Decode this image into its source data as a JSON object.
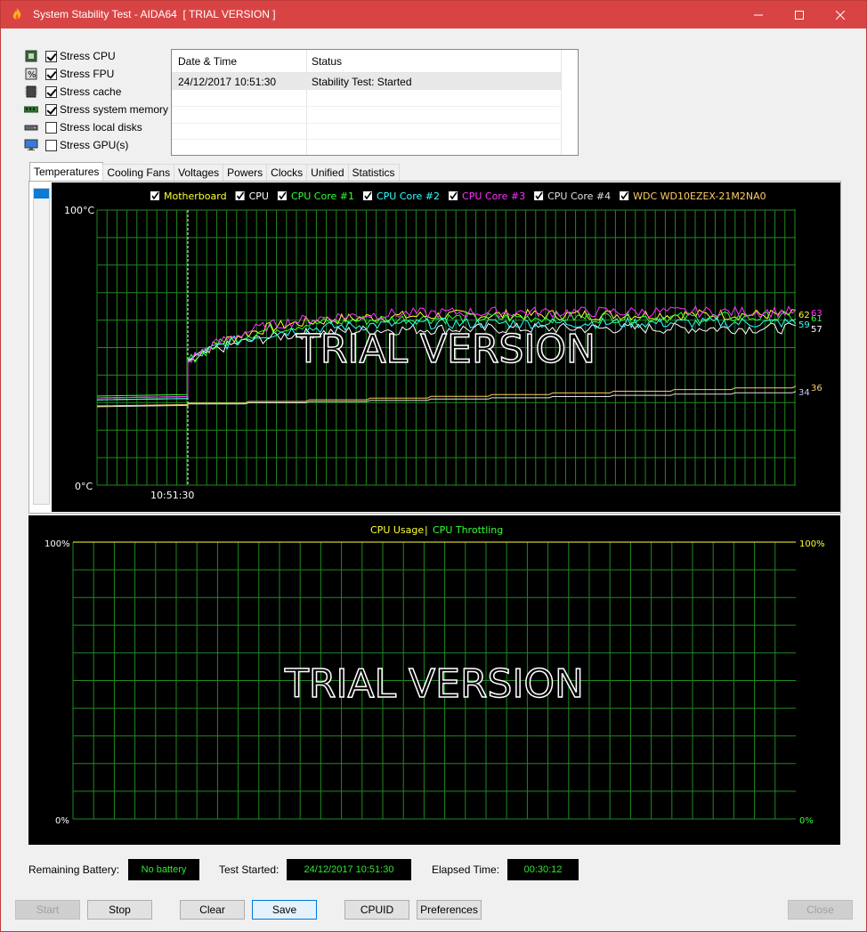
{
  "window": {
    "title": "System Stability Test - AIDA64  [ TRIAL VERSION ]",
    "accent": "#d84444"
  },
  "stress": [
    {
      "label": "Stress CPU",
      "checked": true,
      "icon": "cpu-chip-icon"
    },
    {
      "label": "Stress FPU",
      "checked": true,
      "icon": "fpu-percent-icon"
    },
    {
      "label": "Stress cache",
      "checked": true,
      "icon": "cache-chip-icon"
    },
    {
      "label": "Stress system memory",
      "checked": true,
      "icon": "memory-module-icon"
    },
    {
      "label": "Stress local disks",
      "checked": false,
      "icon": "disk-drive-icon"
    },
    {
      "label": "Stress GPU(s)",
      "checked": false,
      "icon": "monitor-gpu-icon"
    }
  ],
  "log": {
    "columns": [
      "Date & Time",
      "Status"
    ],
    "rows": [
      {
        "datetime": "24/12/2017 10:51:30",
        "status": "Stability Test: Started"
      }
    ]
  },
  "tabs": [
    "Temperatures",
    "Cooling Fans",
    "Voltages",
    "Powers",
    "Clocks",
    "Unified",
    "Statistics"
  ],
  "active_tab": "Temperatures",
  "watermark": "TRIAL VERSION",
  "temp_chart_data": {
    "type": "line",
    "y_top_label": "100°C",
    "y_bottom_label": "0°C",
    "ylim": [
      0,
      100
    ],
    "x_marker_label": "10:51:30",
    "grid": true,
    "legend_position": "top",
    "series": [
      {
        "name": "Motherboard",
        "color": "#ffff33",
        "checked": true,
        "end_value": 62
      },
      {
        "name": "CPU",
        "color": "#ffffff",
        "checked": true,
        "end_value": 57
      },
      {
        "name": "CPU Core #1",
        "color": "#33ff33",
        "checked": true,
        "end_value": 61
      },
      {
        "name": "CPU Core #2",
        "color": "#33ffff",
        "checked": true,
        "end_value": 59
      },
      {
        "name": "CPU Core #3",
        "color": "#ff33ff",
        "checked": true,
        "end_value": 63
      },
      {
        "name": "CPU Core #4",
        "color": "#e0e0e0",
        "checked": true,
        "end_value": 34
      },
      {
        "name": "WDC WD10EZEX-21M2NA0",
        "color": "#ffcc66",
        "checked": true,
        "end_value": 36
      }
    ],
    "end_labels": [
      {
        "text": "62",
        "color": "#ffff33"
      },
      {
        "text": "63",
        "color": "#ff33ff"
      },
      {
        "text": "61",
        "color": "#33ff33"
      },
      {
        "text": "59",
        "color": "#33ffff"
      },
      {
        "text": "57",
        "color": "#ffffff"
      },
      {
        "text": "36",
        "color": "#ffcc66"
      },
      {
        "text": "34",
        "color": "#ccccff"
      }
    ]
  },
  "usage_chart_data": {
    "type": "line",
    "legend": [
      {
        "name": "CPU Usage",
        "color": "#ffff33"
      },
      {
        "name": "CPU Throttling",
        "color": "#33ff33"
      }
    ],
    "separator": "|",
    "y_left_top": "100%",
    "y_left_bottom": "0%",
    "y_right_top": "100%",
    "y_right_bottom": "0%",
    "ylim": [
      0,
      100
    ],
    "grid": true
  },
  "status": {
    "battery_label": "Remaining Battery:",
    "battery_value": "No battery",
    "started_label": "Test Started:",
    "started_value": "24/12/2017 10:51:30",
    "elapsed_label": "Elapsed Time:",
    "elapsed_value": "00:30:12"
  },
  "buttons": {
    "start": "Start",
    "stop": "Stop",
    "clear": "Clear",
    "save": "Save",
    "cpuid": "CPUID",
    "preferences": "Preferences",
    "close": "Close"
  }
}
